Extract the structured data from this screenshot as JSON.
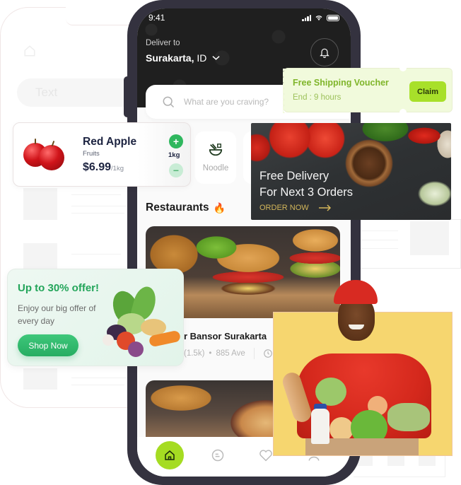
{
  "background_wireframe": {
    "input_placeholder": "Text",
    "home_icon": "home-icon"
  },
  "phone": {
    "status_bar": {
      "time": "9:41",
      "icons": [
        "signal-icon",
        "wifi-icon",
        "battery-icon"
      ]
    },
    "header": {
      "deliver_label": "Deliver to",
      "location_city": "Surakarta,",
      "location_region": "ID",
      "location_icon": "chevron-down-icon",
      "notification_icon": "bell-icon"
    },
    "search": {
      "placeholder": "What are you craving?",
      "icon": "search-icon"
    },
    "categories": [
      {
        "label": "Noodle",
        "icon": "noodle-bowl-icon"
      }
    ],
    "restaurants": {
      "title": "Restaurants",
      "title_emoji": "🔥",
      "items": [
        {
          "name": "r Bansor Surakarta",
          "rating_count": "(1.5k)",
          "separator": "•",
          "address": "885 Ave",
          "time_icon": "clock-icon"
        }
      ]
    },
    "bottom_nav": [
      {
        "name": "home",
        "icon": "home-icon",
        "active": true
      },
      {
        "name": "chat",
        "icon": "chat-icon",
        "active": false
      },
      {
        "name": "favorites",
        "icon": "heart-icon",
        "active": false
      },
      {
        "name": "profile",
        "icon": "user-icon",
        "active": false
      }
    ]
  },
  "voucher": {
    "title": "Free Shipping Voucher",
    "subtitle": "End : 9 hours",
    "claim_label": "Claim",
    "accent_color": "#a8e02a"
  },
  "product_card": {
    "name": "Red Apple",
    "category": "Fruits",
    "price": "$6.99",
    "unit": "/1kg",
    "quantity": "1kg",
    "plus_label": "+",
    "minus_label": "−",
    "accent_color": "#2fb75e"
  },
  "promo_banner": {
    "line1": "Free Delivery",
    "line2": "For Next 3 Orders",
    "cta_label": "ORDER NOW",
    "cta_icon": "arrow-right-icon"
  },
  "offer_card": {
    "title": "Up to  30% offer!",
    "description": "Enjoy our big offer of every day",
    "button_label": "Shop Now",
    "accent_color": "#23a55a"
  },
  "courier_image": {
    "description": "delivery-person-with-grocery-box"
  }
}
